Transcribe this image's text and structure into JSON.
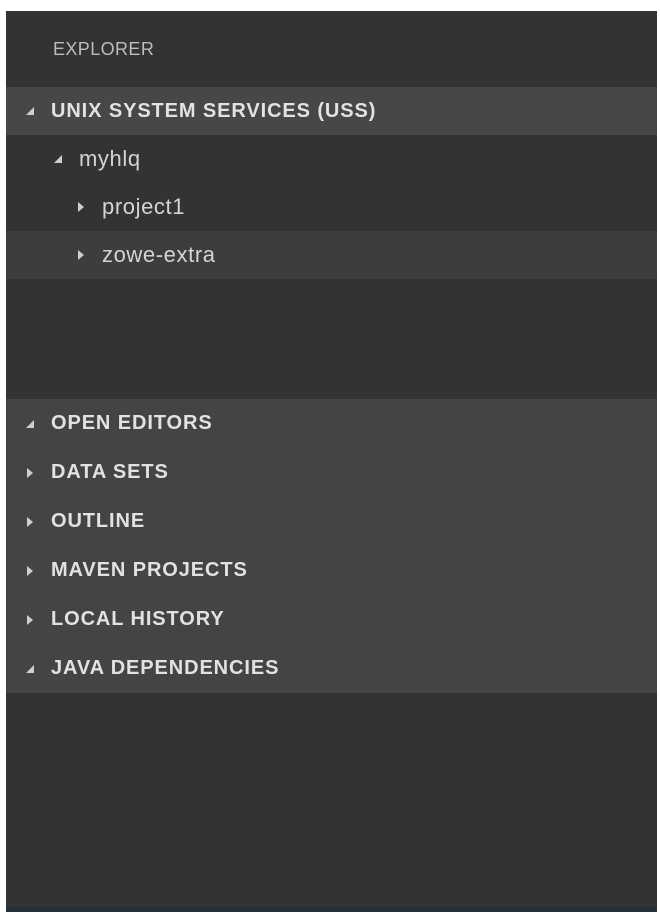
{
  "explorer": {
    "title": "EXPLORER"
  },
  "uss": {
    "header": "UNIX SYSTEM SERVICES (USS)",
    "tree": {
      "root": "myhlq",
      "children": [
        "project1",
        "zowe-extra"
      ]
    }
  },
  "panels": [
    {
      "label": "OPEN EDITORS",
      "expanded": true
    },
    {
      "label": "DATA SETS",
      "expanded": false
    },
    {
      "label": "OUTLINE",
      "expanded": false
    },
    {
      "label": "MAVEN PROJECTS",
      "expanded": false
    },
    {
      "label": "LOCAL HISTORY",
      "expanded": false
    },
    {
      "label": "JAVA DEPENDENCIES",
      "expanded": true
    }
  ],
  "colors": {
    "background": "#333333",
    "header_bg": "#474747",
    "panels_bg": "#444444",
    "selected_row_bg": "#3d3d3d",
    "text": "#e2e2e2"
  }
}
